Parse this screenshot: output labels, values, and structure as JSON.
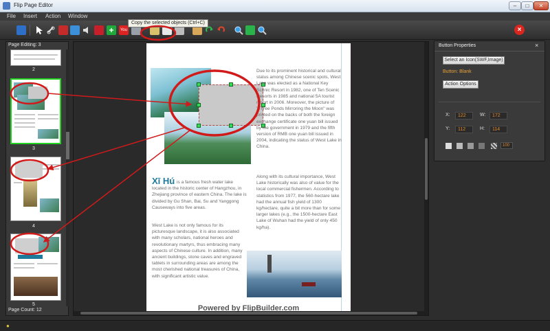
{
  "window": {
    "title": "Flip Page Editor",
    "min_label": "–",
    "max_label": "□",
    "close_label": "✕"
  },
  "menu": [
    "File",
    "Insert",
    "Action",
    "Window"
  ],
  "toolbar": {
    "tooltip": "Copy the selected objects (Ctrl+C)",
    "icons": [
      "save-icon",
      "pointer-icon",
      "link-icon",
      "video-icon",
      "image-icon",
      "audio-icon",
      "flash-icon",
      "add-button-icon",
      "youtube-icon",
      "print-icon",
      "copy-icon",
      "paste-icon",
      "cut-icon",
      "delete-icon",
      "redo-icon",
      "undo-icon",
      "zoom-in-icon",
      "fit-icon",
      "zoom-out-icon"
    ],
    "exit_icon": "exit-icon"
  },
  "left_panel": {
    "page_editing": "Page Editing: 3",
    "page_count": "Page Count: 12",
    "thumbs": [
      {
        "num": "2"
      },
      {
        "num": "3"
      },
      {
        "num": "4"
      },
      {
        "num": "5"
      }
    ]
  },
  "page": {
    "right_col_1": "Due to its prominent historical and cultural status among Chinese scenic spots, West Lake was elected as a National Key Scenic Resort in 1982, one of Ten Scenic Resorts in 1985 and national 5A tourist resort in 2006. Moreover, the picture of \"Three Ponds Mirroring the Moon\" was printed on the backs of both the foreign exchange certificate one yuan bill issued by the government in 1979 and the fifth version of RMB one yuan bill issued in 2004, indicating the status of West Lake in China.",
    "right_col_2": "Along with its cultural importance, West Lake historically was also of value for the local commercial fishermen. According to statistics from 1977, the 560-hectare lake had the annual fish yield of 1300 kg/hectare, quite a bit more than for some larger lakes (e.g., the 1500-hectare East Lake of Wuhan had the yield of only 450 kg/ha).",
    "xihu_title": "Xī Hú",
    "xihu_intro": "is a famous fresh water lake located in the historic center of Hangzhou, in Zhejiang province of eastern China. The lake is divided by Gu Shan, Bai, Su and Yanggong Causeways into five areas.",
    "left_body": "West Lake is not only famous for its picturesque landscape, it is also associated with many scholars, national heroes and revolutionary martyrs, thus embracing many aspects of Chinese culture. In addition, many ancient buildings, stone caves and engraved tablets in surrounding areas are among the most cherished national treasures of China, with significant artistic value.",
    "powered_by": "Powered by FlipBuilder.com"
  },
  "properties": {
    "title": "Button Properties",
    "close": "×",
    "select_icon_label": "Select an Icon(SWF,Image)",
    "button_blank": "Button: Blank",
    "action_options_label": "Action Options",
    "x_label": "X:",
    "x_value": "122",
    "w_label": "W:",
    "w_value": "172",
    "y_label": "Y:",
    "y_value": "112",
    "h_label": "H:",
    "h_value": "114",
    "zoom_value": "100"
  },
  "status": {
    "icon": "lightbulb-icon"
  },
  "colors": {
    "accent_green": "#21d321",
    "annotation_red": "#d11a1a",
    "value_orange": "#e58a2c"
  }
}
